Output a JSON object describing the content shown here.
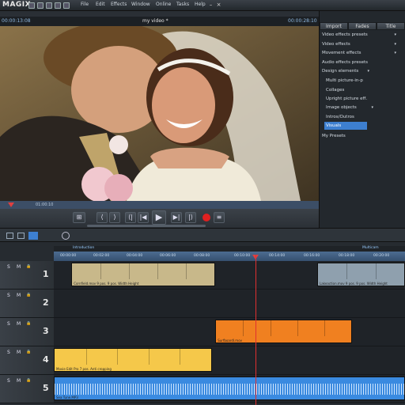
{
  "app": {
    "logo": "MAGIX",
    "menu": [
      "File",
      "Edit",
      "Effects",
      "Window",
      "Online",
      "Tasks",
      "Help"
    ],
    "window_controls": [
      "minimize-icon",
      "close-icon"
    ]
  },
  "preview": {
    "timecode_left": "00:00:13:08",
    "title": "my video *",
    "timecode_right": "00:00:28:10",
    "scrub_timecode": "01:00:10"
  },
  "transport": {
    "buttons": [
      "marker-icon",
      "prev-marker-icon",
      "next-marker-icon",
      "to-start-icon",
      "play-icon",
      "to-end-icon",
      "skip-icon",
      "record-icon",
      "menu-icon"
    ]
  },
  "right_panel": {
    "tabs": [
      "Import",
      "Fades",
      "Title"
    ],
    "items": [
      {
        "label": "Video effects presets",
        "arrow": "▾"
      },
      {
        "label": "Video effects",
        "arrow": "▾"
      },
      {
        "label": "Movement effects",
        "arrow": "▾"
      },
      {
        "label": "Audio effects presets",
        "arrow": ""
      },
      {
        "label": "Design elements",
        "arrow": "▾"
      },
      {
        "label": "Multi picture-in-p",
        "arrow": ""
      },
      {
        "label": "Collages",
        "arrow": ""
      },
      {
        "label": "Upright picture eff.",
        "arrow": ""
      },
      {
        "label": "Image objects",
        "arrow": "▾"
      },
      {
        "label": "Intros/Outros",
        "arrow": ""
      },
      {
        "label": "Visuals",
        "arrow": ""
      },
      {
        "label": "My Presets",
        "arrow": ""
      }
    ],
    "selected": "Visuals"
  },
  "timeline": {
    "markers": [
      "Introduction",
      "Multicam"
    ],
    "ruler_ticks": [
      "00:00:00",
      "00:02:00",
      "00:04:00",
      "00:06:00",
      "00:08:00",
      "00:10:00",
      "00:12:00",
      "00:14:00",
      "00:16:00",
      "00:18:00",
      "00:20:00"
    ],
    "playhead_fraction": 0.574,
    "tracks": [
      {
        "number": "1",
        "controls": [
          "S",
          "M"
        ],
        "clips": [
          {
            "label": "Cornfield.mov  9 pos.  9 pos.  Width  Height",
            "start": 0.05,
            "end": 0.46,
            "color": "#c8b88a"
          },
          {
            "label": "Lakeaction.mov  9 pos.  9 pos.  Width  Height",
            "start": 0.75,
            "end": 1.0,
            "color": "#8fa0ae"
          }
        ]
      },
      {
        "number": "2",
        "controls": [
          "S",
          "M"
        ],
        "clips": []
      },
      {
        "number": "3",
        "controls": [
          "S",
          "M"
        ],
        "clips": [
          {
            "label": "Surfboardl.mov",
            "start": 0.46,
            "end": 0.85,
            "color": "#f08020"
          }
        ]
      },
      {
        "number": "4",
        "controls": [
          "S",
          "M"
        ],
        "clips": [
          {
            "label": "Movie Edit Pro  7 pos.  Anti cropping",
            "start": 0.0,
            "end": 0.45,
            "color": "#f5c84a"
          }
        ]
      },
      {
        "number": "5",
        "controls": [
          "S",
          "M"
        ],
        "clips": [
          {
            "label": "Sea Tune.MP3",
            "start": 0.0,
            "end": 1.0,
            "color": "#3a8ae0"
          }
        ]
      }
    ]
  }
}
